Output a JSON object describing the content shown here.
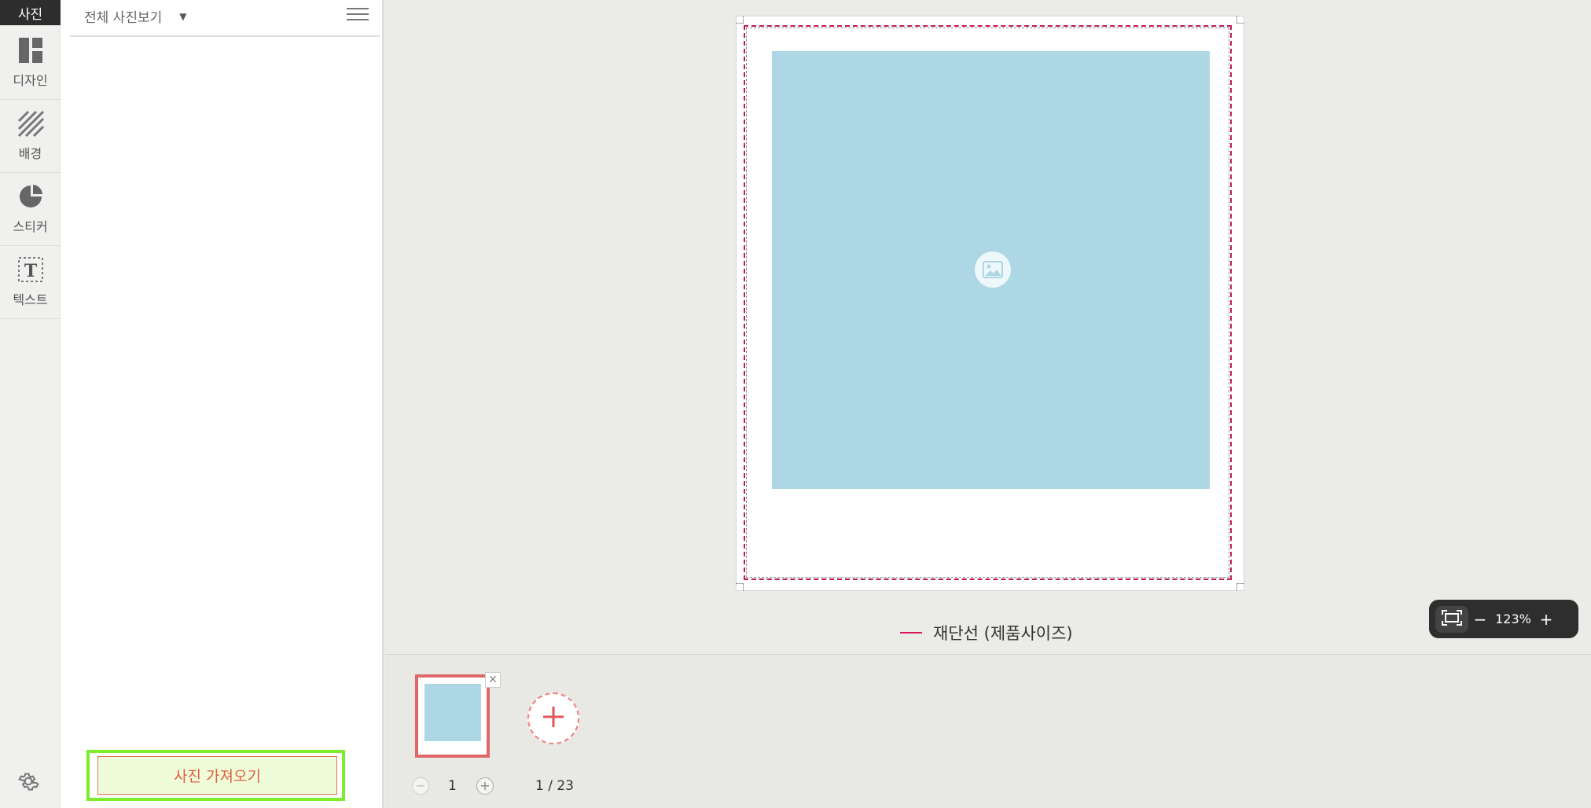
{
  "rail": {
    "active_label": "사진",
    "items": [
      {
        "label": "디자인",
        "icon": "layout-icon"
      },
      {
        "label": "배경",
        "icon": "pattern-icon"
      },
      {
        "label": "스티커",
        "icon": "sticker-icon"
      },
      {
        "label": "텍스트",
        "icon": "text-icon"
      }
    ],
    "settings_icon": "gear-icon"
  },
  "panel": {
    "view_select": "전체 사진보기",
    "caret": "▼",
    "import_button": "사진 가져오기"
  },
  "canvas": {
    "cut_line_label": "재단선 (제품사이즈)",
    "zoom_value": "123%",
    "zoom_minus": "−",
    "zoom_plus": "+"
  },
  "pages": {
    "current": "1",
    "indicator": "1 / 23",
    "minus": "−",
    "plus": "+",
    "close": "✕"
  },
  "colors": {
    "cut_line": "#d81b60",
    "photo_slot": "#aed7e5",
    "import_border": "#7ded2b",
    "accent": "#e06767"
  }
}
